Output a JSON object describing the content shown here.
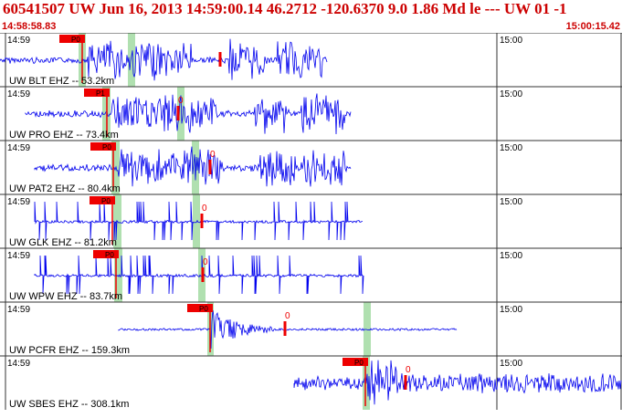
{
  "header": {
    "title": "60541507 UW Jun 16, 2013 14:59:00.14    46.2712 -120.6370  9.0 1.86 Md le --- UW 01   -1",
    "start_time": "14:58:58.83",
    "end_time": "15:00:15.42"
  },
  "colors": {
    "trace": "#0000ee",
    "pick": "#ee0000",
    "prediction_band": "#b0e0b0",
    "grid": "#333333",
    "header_text": "#cc0000"
  },
  "panels": [
    {
      "label": "UW BLT EHZ -- 53.2km",
      "time_left": "14:59",
      "time_right": "15:00",
      "pick_label": "P0",
      "s_label": ""
    },
    {
      "label": "UW PRO EHZ -- 73.4km",
      "time_left": "14:59",
      "time_right": "15:00",
      "pick_label": "P1",
      "s_label": "0"
    },
    {
      "label": "UW PAT2 EHZ -- 80.4km",
      "time_left": "14:59",
      "time_right": "15:00",
      "pick_label": "P0",
      "s_label": "0"
    },
    {
      "label": "UW GLK EHZ -- 81.2km",
      "time_left": "14:59",
      "time_right": "15:00",
      "pick_label": "P0",
      "s_label": "0"
    },
    {
      "label": "UW WPW EHZ -- 83.7km",
      "time_left": "14:59",
      "time_right": "15:00",
      "pick_label": "P0",
      "s_label": "0"
    },
    {
      "label": "UW PCFR EHZ -- 159.3km",
      "time_left": "14:59",
      "time_right": "15:00",
      "pick_label": "P0",
      "s_label": "0"
    },
    {
      "label": "UW SBES EHZ -- 308.1km",
      "time_left": "14:59",
      "time_right": "15:00",
      "pick_label": "P0",
      "s_label": "0"
    }
  ]
}
